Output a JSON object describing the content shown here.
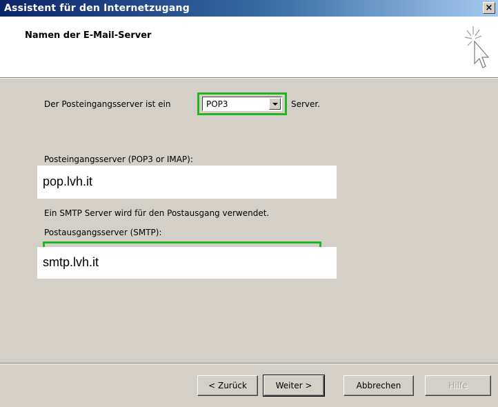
{
  "window": {
    "title": "Assistent für den Internetzugang",
    "close_label": "×"
  },
  "header": {
    "title": "Namen der E-Mail-Server"
  },
  "incoming_type": {
    "label_before": "Der Posteingangsserver ist ein",
    "selected": "POP3",
    "label_after": "Server."
  },
  "incoming": {
    "label": "Posteingangsserver (POP3 or IMAP):",
    "value": "pop.lvh.it"
  },
  "smtp_info": "Ein SMTP Server wird für den Postausgang verwendet.",
  "outgoing": {
    "label": "Postausgangsserver (SMTP):",
    "value": "smtp.lvh.it"
  },
  "buttons": {
    "back": "< Zurück",
    "next": "Weiter >",
    "cancel": "Abbrechen",
    "help": "Hilfe"
  },
  "colors": {
    "highlight": "#22b522",
    "titlebar_start": "#0a246a",
    "dialog_bg": "#d4d0c8"
  }
}
